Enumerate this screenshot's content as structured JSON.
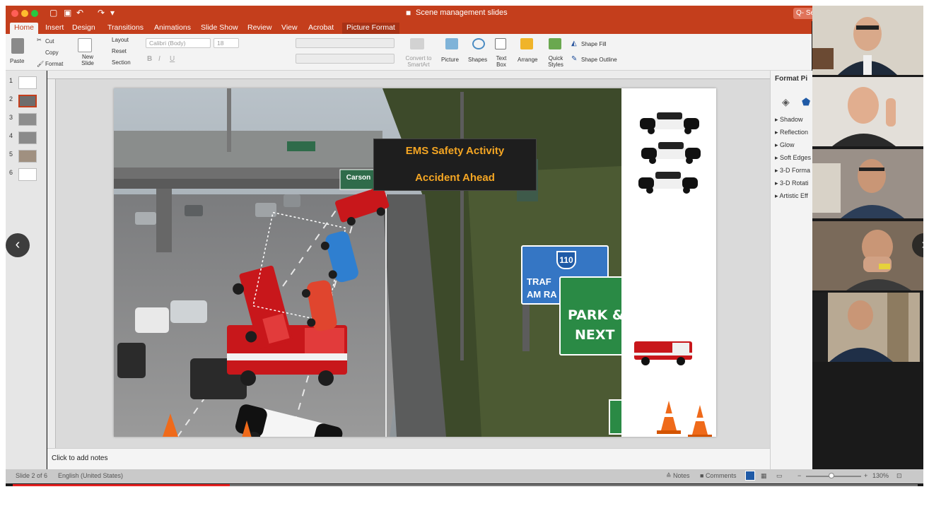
{
  "window": {
    "title": "Scene management slides",
    "search": "Q- Sear"
  },
  "tabs": [
    {
      "label": "Home"
    },
    {
      "label": "Insert"
    },
    {
      "label": "Design"
    },
    {
      "label": "Transitions"
    },
    {
      "label": "Animations"
    },
    {
      "label": "Slide Show"
    },
    {
      "label": "Review"
    },
    {
      "label": "View"
    },
    {
      "label": "Acrobat"
    },
    {
      "label": "Picture Format"
    }
  ],
  "ribbon": {
    "paste": "Paste",
    "cut": "Cut",
    "copy": "Copy",
    "format": "Format",
    "new_slide": "New Slide",
    "layout": "Layout",
    "reset": "Reset",
    "section": "Section",
    "font_name": "Calibri (Body)",
    "font_size": "18",
    "convert_smartart": "Convert to SmartArt",
    "picture": "Picture",
    "shapes": "Shapes",
    "text_box": "Text Box",
    "arrange": "Arrange",
    "quick_styles": "Quick Styles",
    "shape_fill": "Shape Fill",
    "shape_outline": "Shape Outline"
  },
  "slides_panel": {
    "numbers": [
      "1",
      "2",
      "3",
      "4",
      "5",
      "6"
    ],
    "selected": 2
  },
  "slide": {
    "sign_line1": "EMS Safety Activity",
    "sign_line2": "Accident Ahead",
    "overpass_sign": "Carson",
    "route_shield": "110",
    "traffic_sign_1": "TRAF",
    "traffic_sign_2": "AM RA",
    "park_sign_1": "PARK &",
    "park_sign_2": "NEXT"
  },
  "notes": {
    "placeholder": "Click to add notes"
  },
  "format_pane": {
    "title": "Format Pi",
    "items": [
      "Shadow",
      "Reflection",
      "Glow",
      "Soft Edges",
      "3-D Forma",
      "3-D Rotati",
      "Artistic Eff"
    ]
  },
  "statusbar": {
    "slide_info": "Slide 2 of 6",
    "language": "English (United States)",
    "notes": "Notes",
    "comments": "Comments",
    "zoom": "130%"
  },
  "player": {
    "progress_fraction": 0.24
  },
  "colors": {
    "brand": "#c43e1c",
    "sign_text": "#f5a623"
  }
}
